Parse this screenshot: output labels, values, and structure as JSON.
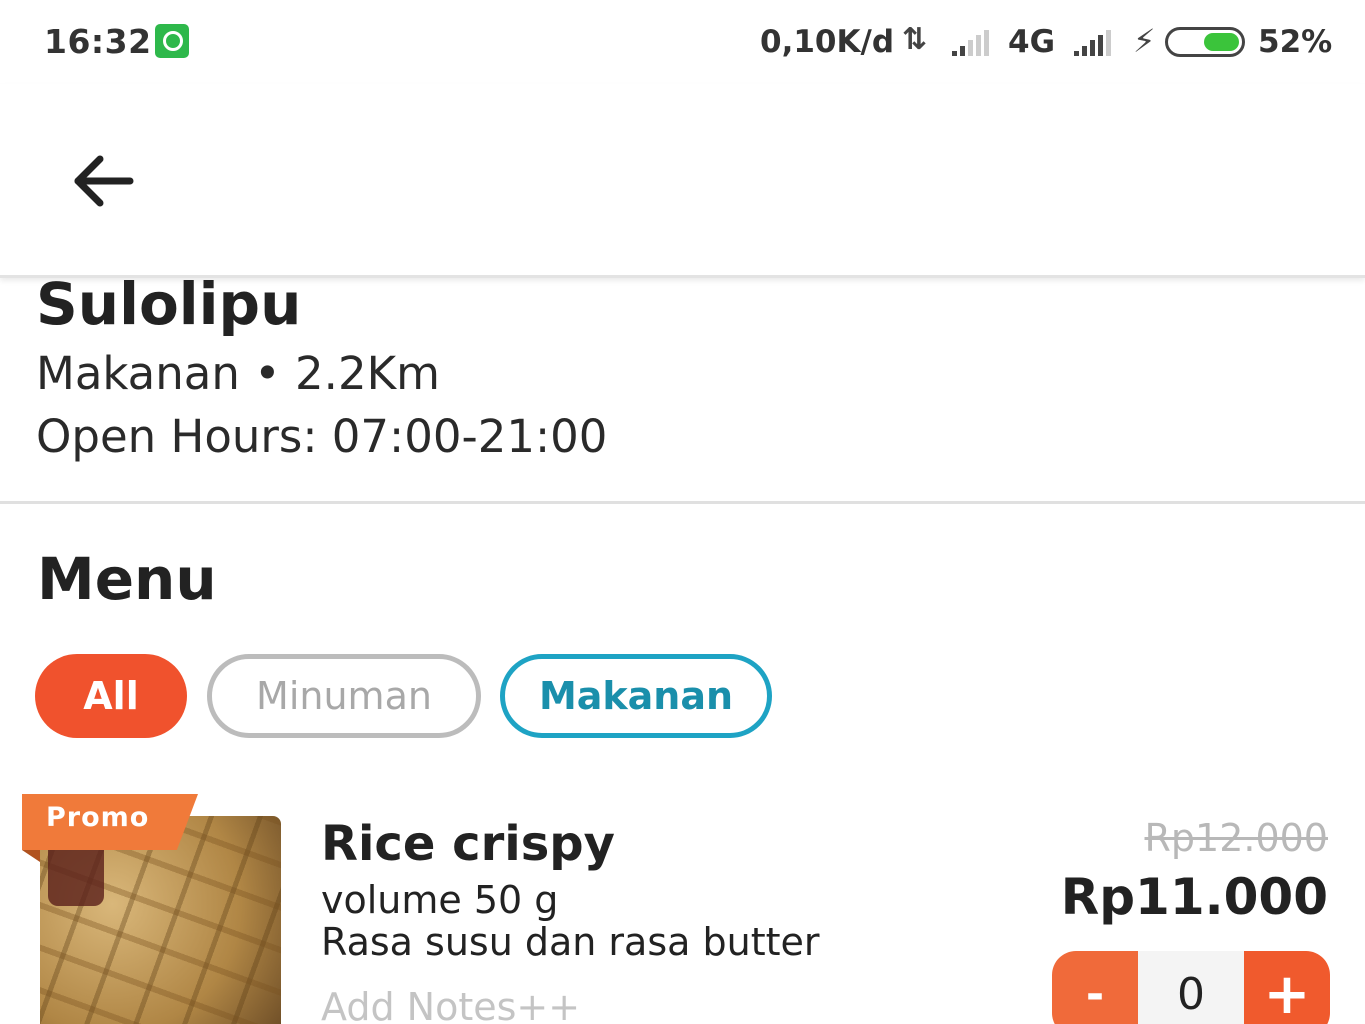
{
  "status_bar": {
    "time": "16:32",
    "notification_icon": "whatsapp-icon",
    "network_speed": "0,10K/d",
    "data_arrows": "⇅",
    "network_type": "4G",
    "battery_percent": "52%",
    "battery_level": 0.52,
    "battery_color": "#3bc43b"
  },
  "app_bar": {
    "back_icon": "arrow-left-icon"
  },
  "store": {
    "name": "Sulolipu",
    "meta": "Makanan • 2.2Km",
    "hours": "Open Hours: 07:00-21:00"
  },
  "menu": {
    "title": "Menu",
    "categories": [
      {
        "label": "All",
        "selected": true
      },
      {
        "label": "Minuman",
        "selected": false
      },
      {
        "label": "Makanan",
        "selected": false
      }
    ],
    "items": [
      {
        "badge": "Promo",
        "name": "Rice crispy",
        "desc_line1": "volume 50 g",
        "desc_line2": "Rasa susu dan rasa butter",
        "notes_placeholder": "Add Notes++",
        "original_price": "Rp12.000",
        "price": "Rp11.000",
        "quantity": "0",
        "minus_label": "-",
        "plus_label": "+"
      }
    ]
  },
  "colors": {
    "accent": "#f0522d",
    "teal": "#1ea3c4",
    "promo": "#f07a3a"
  }
}
